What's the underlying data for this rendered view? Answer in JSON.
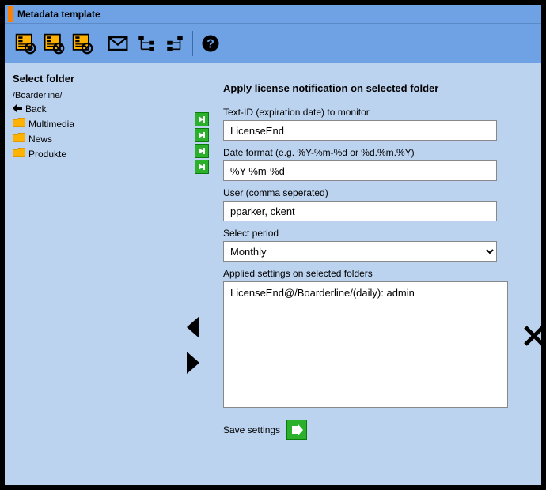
{
  "titlebar": {
    "title": "Metadata template"
  },
  "sidebar": {
    "heading": "Select folder",
    "path": "/Boarderline/",
    "back_label": "Back",
    "folders": [
      {
        "label": "Multimedia"
      },
      {
        "label": "News"
      },
      {
        "label": "Produkte"
      }
    ]
  },
  "form": {
    "heading": "Apply license notification on selected folder",
    "labels": {
      "textid": "Text-ID (expiration date) to monitor",
      "dateformat": "Date format (e.g. %Y-%m-%d or %d.%m.%Y)",
      "user": "User (comma seperated)",
      "period": "Select period",
      "applied": "Applied settings on selected folders"
    },
    "values": {
      "textid": "LicenseEnd",
      "dateformat": "%Y-%m-%d",
      "user": "pparker, ckent",
      "period": "Monthly",
      "applied": "LicenseEnd@/Boarderline/(daily): admin"
    },
    "save_label": "Save settings"
  }
}
